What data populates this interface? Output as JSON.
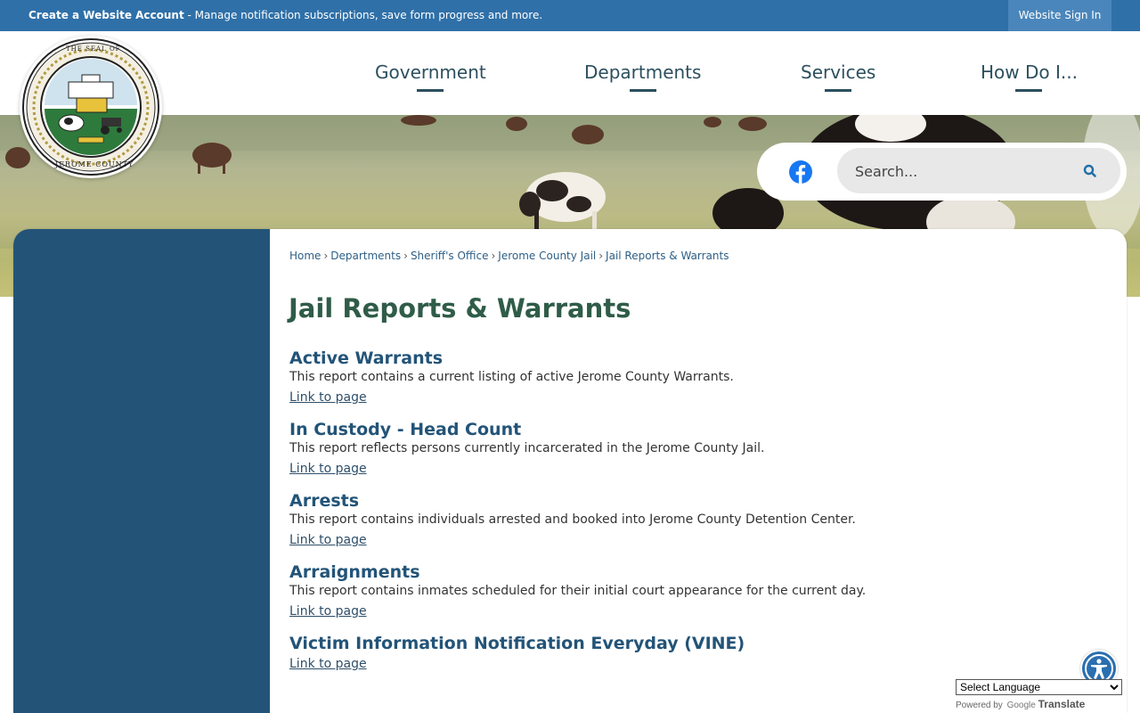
{
  "topbar": {
    "account_bold": "Create a Website Account",
    "account_rest": " - Manage notification subscriptions, save form progress and more.",
    "signin_label": "Website Sign In"
  },
  "nav": {
    "items": [
      {
        "label": "Government"
      },
      {
        "label": "Departments"
      },
      {
        "label": "Services"
      },
      {
        "label": "How Do I..."
      }
    ]
  },
  "seal": {
    "top_text": "THE SEAL OF",
    "bottom_text": "JEROME COUNTY"
  },
  "search": {
    "placeholder": "Search..."
  },
  "breadcrumb": [
    {
      "label": "Home"
    },
    {
      "label": "Departments"
    },
    {
      "label": "Sheriff's Office"
    },
    {
      "label": "Jerome County Jail"
    },
    {
      "label": "Jail Reports & Warrants"
    }
  ],
  "page": {
    "title": "Jail Reports & Warrants",
    "reports": [
      {
        "title": "Active Warrants",
        "description": "This report contains a current listing of active Jerome County Warrants.",
        "link": "Link to page"
      },
      {
        "title": "In Custody - Head Count",
        "description": "This report reflects persons currently incarcerated in the Jerome County Jail.",
        "link": "Link to page"
      },
      {
        "title": "Arrests",
        "description": "This report contains individuals arrested and booked into Jerome County Detention Center.",
        "link": "Link to page"
      },
      {
        "title": "Arraignments",
        "description": "This report contains inmates scheduled for their initial court appearance for the current day.",
        "link": "Link to page"
      },
      {
        "title": "Victim Information Notification Everyday (VINE)",
        "description": "",
        "link": "Link to page"
      }
    ]
  },
  "translate": {
    "select_label": "Select Language",
    "powered_by": "Powered by",
    "google": "Google",
    "translate_word": "Translate"
  },
  "colors": {
    "topbar": "#2f70a8",
    "sidebar": "#235478",
    "title": "#2f5c48",
    "report_heading": "#235478",
    "nav_text": "#2c4f5e"
  }
}
